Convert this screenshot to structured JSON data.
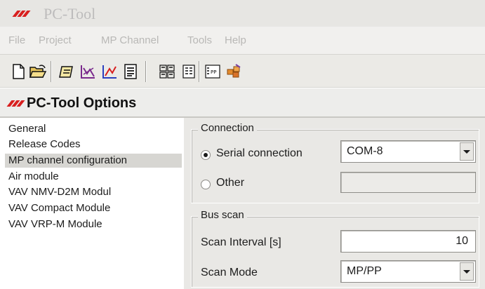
{
  "app": {
    "title": "PC-Tool"
  },
  "menu": [
    {
      "label": "File"
    },
    {
      "label": "Project"
    },
    {
      "label": "MP Channel"
    },
    {
      "label": "Tools"
    },
    {
      "label": "Help"
    }
  ],
  "toolbar_icons": [
    "new-document-icon",
    "open-folder-icon",
    "edit-icon",
    "graph-icon",
    "trend-chart-icon",
    "report-icon",
    "scan-icon",
    "list-icon",
    "bpp-icon",
    "export-icon"
  ],
  "options": {
    "title": "PC-Tool Options",
    "nav": [
      {
        "label": "General"
      },
      {
        "label": "Release Codes"
      },
      {
        "label": "MP channel configuration",
        "selected": true
      },
      {
        "label": "Air module"
      },
      {
        "label": "VAV NMV-D2M Modul"
      },
      {
        "label": "VAV Compact Module"
      },
      {
        "label": "VAV VRP-M Module"
      }
    ]
  },
  "connection": {
    "legend": "Connection",
    "serial_label": "Serial connection",
    "serial_checked": true,
    "port_value": "COM-8",
    "other_label": "Other",
    "other_checked": false,
    "other_value": ""
  },
  "bus_scan": {
    "legend": "Bus scan",
    "interval_label": "Scan Interval [s]",
    "interval_value": "10",
    "mode_label": "Scan Mode",
    "mode_value": "MP/PP"
  },
  "colors": {
    "brand_red": "#d81f1f",
    "selected_row": "#d7d6d2",
    "panel_bg": "#e9e8e5"
  }
}
